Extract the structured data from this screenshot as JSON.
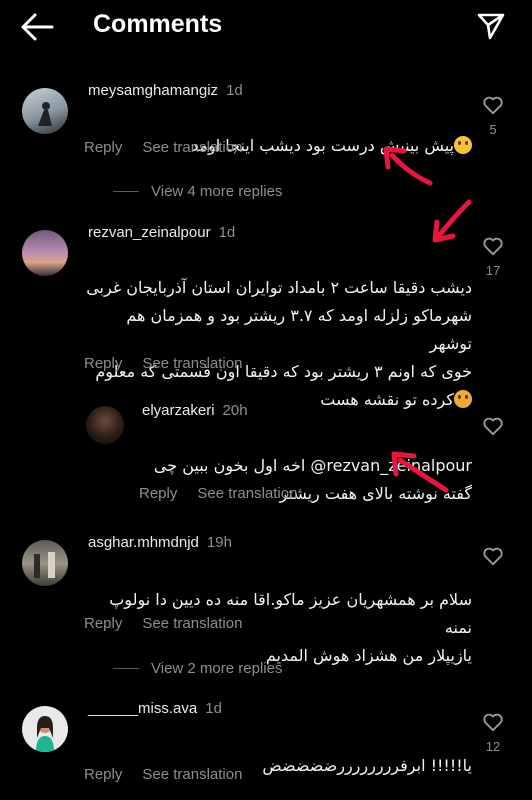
{
  "header": {
    "title": "Comments",
    "back_icon": "back-arrow-icon",
    "send_icon": "paper-plane-icon"
  },
  "comments": [
    {
      "username": "meysamghamangiz",
      "time": "1d",
      "text": "پیش بینیش درست بود دیشب اینجا اومد",
      "reply": "Reply",
      "translate": "See translation",
      "likes": "5"
    },
    {
      "username": "rezvan_zeinalpour",
      "time": "1d",
      "text": "دیشب دقیقا ساعت ۲ بامداد توایران استان آذربایجان غربی\nشهرماکو زلزله اومد که ۳.۷ ریشتر بود و همزمان هم توشهر\nخوی که اونم ۳ ریشتر بود که دقیقا اون قسمتی که معلوم\nکرده تو نقشه هست",
      "reply": "Reply",
      "translate": "See translation",
      "likes": "17"
    },
    {
      "username": "elyarzakeri",
      "time": "20h",
      "text": "اخه اول بخون ببین چی @rezvan_zeinalpour\nگفته نوشته بالای هفت ریشتر",
      "reply": "Reply",
      "translate": "See translation",
      "likes": ""
    },
    {
      "username": "asghar.mhmdnjd",
      "time": "19h",
      "text": "سلام بر همشهریان عزیز ماکو.اقا منه ده دیین دا نولوپ نمنه\nیازیپلار من هشزاد هوش المدیم",
      "reply": "Reply",
      "translate": "See translation",
      "likes": ""
    },
    {
      "username": "______miss.ava",
      "time": "1d",
      "text": "یا!!!!! ابرفررررررررضضضضض",
      "reply": "Reply",
      "translate": "See translation",
      "likes": "12"
    }
  ],
  "view_more": [
    "View 4 more replies",
    "View 2 more replies"
  ],
  "colors": {
    "background": "#000000",
    "text": "#f5f5f5",
    "muted": "#8e8e8e",
    "annotation_arrow": "#e5173f"
  }
}
